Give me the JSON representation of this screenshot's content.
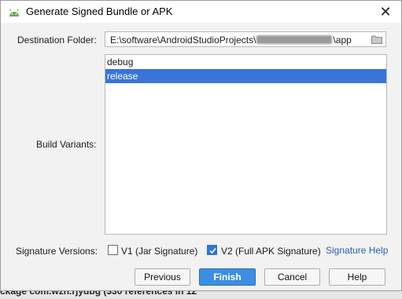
{
  "dialog": {
    "title": "Generate Signed Bundle or APK",
    "close_symbol": "✕"
  },
  "destination": {
    "label": "Destination Folder:",
    "path_prefix": "E:\\software\\AndroidStudioProjects\\",
    "path_suffix": "\\app",
    "icon": "folder-icon"
  },
  "build_variants": {
    "label": "Build Variants:",
    "items": [
      "debug",
      "release"
    ],
    "selected": "release"
  },
  "signature": {
    "label": "Signature Versions:",
    "v1_label": "V1 (Jar Signature)",
    "v1_checked": false,
    "v2_label": "V2 (Full APK Signature)",
    "v2_checked": true,
    "help_link": "Signature Help"
  },
  "buttons": {
    "previous": "Previous",
    "finish": "Finish",
    "cancel": "Cancel",
    "help": "Help"
  },
  "background": {
    "status_text": "ckage com.wzh.rjydbg (330 references in 12"
  },
  "colors": {
    "accent": "#3875d7",
    "link": "#2a5db0",
    "primary_button": "#3d8ee0"
  }
}
